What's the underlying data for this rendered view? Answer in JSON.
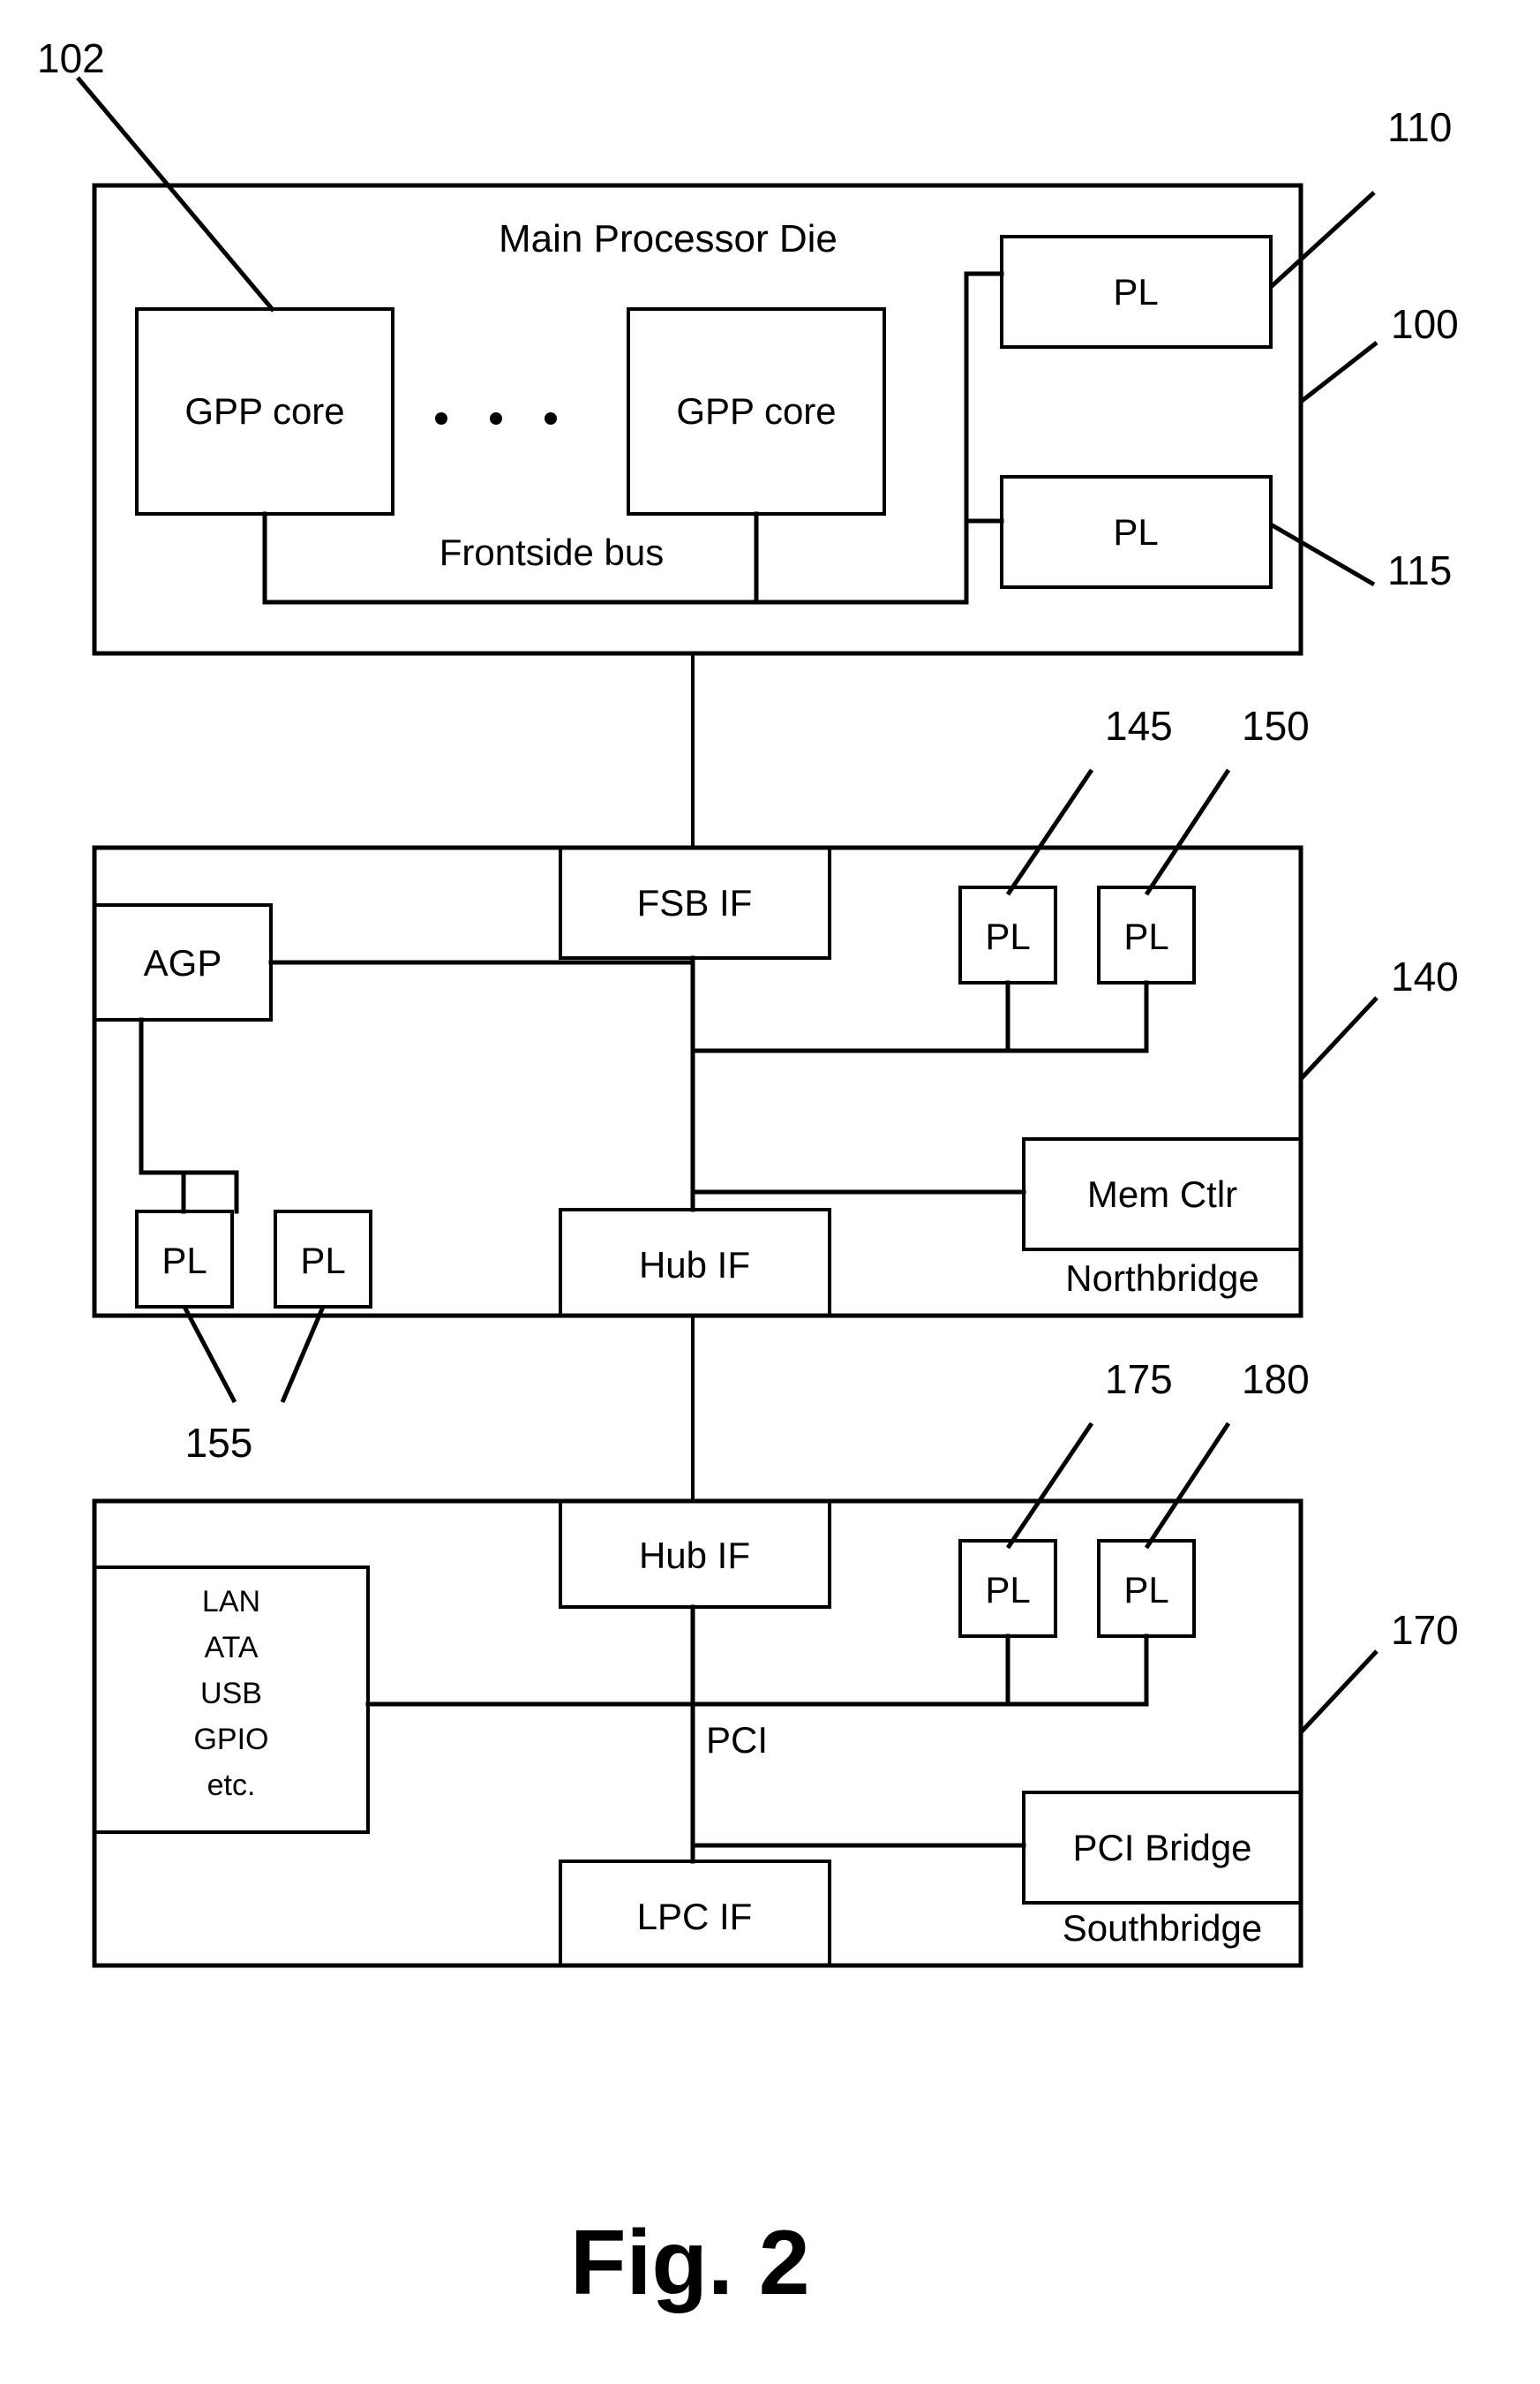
{
  "figure": {
    "caption": "Fig. 2"
  },
  "blocks": {
    "main_die": {
      "title": "Main Processor Die",
      "ref_label": "100",
      "core_ref_label": "102",
      "cores": [
        {
          "label": "GPP core"
        },
        {
          "label": "GPP core"
        }
      ],
      "ellipsis_dots": 3,
      "bus_label": "Frontside bus",
      "pls": [
        {
          "label": "PL",
          "ref_label": "110"
        },
        {
          "label": "PL",
          "ref_label": "115"
        }
      ]
    },
    "northbridge": {
      "title": "Northbridge",
      "ref_label": "140",
      "fsb_if": "FSB IF",
      "agp": "AGP",
      "hub_if": "Hub IF",
      "mem_ctlr": "Mem Ctlr",
      "top_pls": [
        {
          "label": "PL",
          "ref_label": "145"
        },
        {
          "label": "PL",
          "ref_label": "150"
        }
      ],
      "agp_pls": [
        {
          "label": "PL"
        },
        {
          "label": "PL"
        }
      ],
      "agp_pls_ref_label": "155"
    },
    "southbridge": {
      "title": "Southbridge",
      "ref_label": "170",
      "hub_if": "Hub IF",
      "bus_label": "PCI",
      "io_lines": [
        "LAN",
        "ATA",
        "USB",
        "GPIO",
        "etc."
      ],
      "lpc_if": "LPC IF",
      "pci_bridge": "PCI Bridge",
      "top_pls": [
        {
          "label": "PL",
          "ref_label": "175"
        },
        {
          "label": "PL",
          "ref_label": "180"
        }
      ]
    }
  },
  "colors": {
    "line": "#000000",
    "background": "#ffffff"
  }
}
